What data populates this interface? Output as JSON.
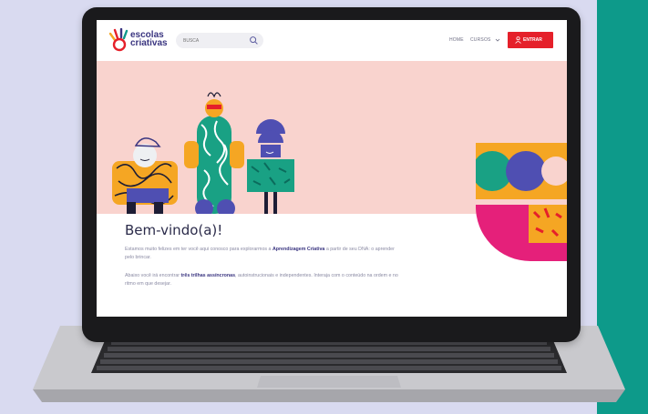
{
  "site": {
    "logo_text_line1": "escolas",
    "logo_text_line2": "criativas"
  },
  "header": {
    "search_placeholder": "BUSCA",
    "nav_home": "HOME",
    "nav_cursos": "CURSOS",
    "entrar_label": "ENTRAR"
  },
  "content": {
    "title": "Bem-vindo(a)!",
    "p1_a": "Estamos muito felizes em ter você aqui conosco para explorarmos a ",
    "p1_b": "Aprendizagem Criativa",
    "p1_c": " a partir de seu DNA: o aprender pelo brincar.",
    "p2_a": "Abaixo você irá encontrar ",
    "p2_b": "três trilhas assíncronas",
    "p2_c": ", autoinstrucionais e independentes. Interaja com o conteúdo na ordem e no ritmo em que desejar."
  },
  "colors": {
    "accent_red": "#e5202a",
    "brand_purple": "#3a3580",
    "hero_bg": "#f9d3ce",
    "teal": "#0d9a8a",
    "page_bg": "#d9daf0"
  },
  "icons": [
    "search-icon",
    "chevron-down-icon",
    "user-icon",
    "logo-hand-icon"
  ]
}
